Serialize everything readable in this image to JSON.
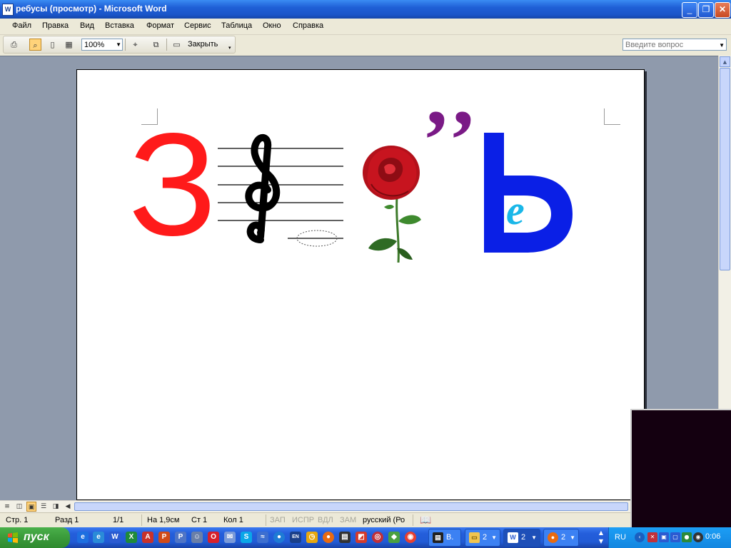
{
  "window": {
    "title": "ребусы (просмотр) - Microsoft Word",
    "icon": "word-doc-icon"
  },
  "menu": [
    "Файл",
    "Правка",
    "Вид",
    "Вставка",
    "Формат",
    "Сервис",
    "Таблица",
    "Окно",
    "Справка"
  ],
  "ask_placeholder": "Введите вопрос",
  "toolbar": {
    "zoom": "100%",
    "close_label": "Закрыть"
  },
  "rebus": {
    "letter_z": "З",
    "commas": "’’",
    "letter_soft": "Ь",
    "inner_e": "е",
    "colors": {
      "red": "#ff1a1a",
      "purple": "#7a1a86",
      "blue": "#0a1fe6",
      "cyan": "#1ab7e8"
    }
  },
  "status": {
    "page": "Стр. 1",
    "section": "Разд 1",
    "pages": "1/1",
    "at": "На 1,9см",
    "line": "Ст 1",
    "col": "Кол 1",
    "rec": "ЗАП",
    "trk": "ИСПР",
    "ext": "ВДЛ",
    "ovr": "ЗАМ",
    "lang": "русский (Ро"
  },
  "taskbar": {
    "start": "пуск",
    "tasks": [
      {
        "label": "B.",
        "icon": "console-icon"
      },
      {
        "label": "2",
        "icon": "folder-icon"
      },
      {
        "label": "2",
        "icon": "word-icon"
      },
      {
        "label": "2",
        "icon": "firefox-icon"
      }
    ],
    "lang": "RU",
    "clock": "0:06"
  }
}
